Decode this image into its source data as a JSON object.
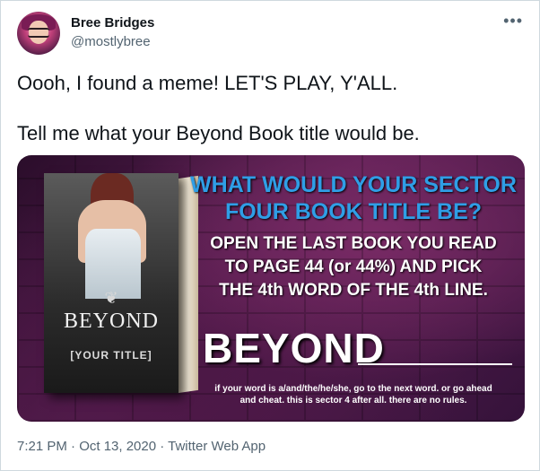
{
  "author": {
    "name": "Bree Bridges",
    "handle": "@mostlybree"
  },
  "more_icon": "more-horizontal-icon",
  "tweet": {
    "paragraphs": [
      "Oooh, I found a meme! LET'S PLAY, Y'ALL.",
      "Tell me what your Beyond Book title would be."
    ]
  },
  "image": {
    "book_title": "BEYOND",
    "book_subtitle": "[YOUR TITLE]",
    "headline_line1": "WHAT WOULD YOUR SECTOR",
    "headline_line2": "FOUR BOOK TITLE BE?",
    "instruction_line1": "OPEN THE LAST BOOK YOU READ",
    "instruction_line2": "TO PAGE 44 (or 44%) AND PICK",
    "instruction_line3": "THE 4th WORD OF THE 4th LINE.",
    "big_word": "BEYOND",
    "footnote_line1": "if your word is a/and/the/he/she, go to the next word. or go ahead",
    "footnote_line2": "and cheat. this is sector 4 after all. there are no rules."
  },
  "meta": {
    "time": "7:21 PM · Oct 13, 2020 · Twitter Web App"
  }
}
